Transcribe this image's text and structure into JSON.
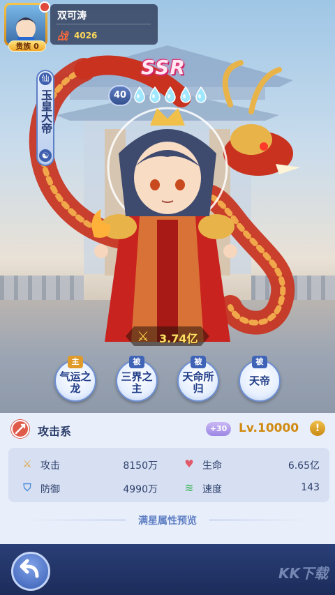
{
  "player": {
    "name": "双可涛",
    "vip_label": "贵族 0",
    "power_glyph": "战",
    "power": "4026"
  },
  "hero": {
    "title": "玉皇大帝",
    "faction_glyph": "仙",
    "camp_glyph": "☯",
    "rarity": "SSR",
    "level": "40",
    "star_count": 5,
    "battle_power": "3.74亿"
  },
  "skills": [
    {
      "type": "主",
      "name": "气运之龙",
      "kind": "main"
    },
    {
      "type": "被",
      "name": "三界之主",
      "kind": "passive"
    },
    {
      "type": "被",
      "name": "天命所归",
      "kind": "passive"
    },
    {
      "type": "被",
      "name": "天帝",
      "kind": "passive"
    }
  ],
  "attr": {
    "class_label": "攻击系",
    "bonus": "+30",
    "level_cap": "Lv.10000",
    "info_glyph": "!"
  },
  "stats": [
    {
      "label": "攻击",
      "value": "8150万",
      "icon": "sword-icon",
      "glyph": "⚔",
      "color": "#e0a23a"
    },
    {
      "label": "生命",
      "value": "6.65亿",
      "icon": "heart-icon",
      "glyph": "♥",
      "color": "#e05a6a"
    },
    {
      "label": "防御",
      "value": "4990万",
      "icon": "shield-icon",
      "glyph": "⛉",
      "color": "#4a8ad8"
    },
    {
      "label": "速度",
      "value": "143",
      "icon": "wind-icon",
      "glyph": "≋",
      "color": "#4cb86a"
    }
  ],
  "preview_label": "满星属性预览",
  "footer": {
    "back_glyph": "↩",
    "watermark": "KK下载"
  },
  "colors": {
    "accent": "#3f63b6",
    "gold": "#ffd95a",
    "level": "#d08a10"
  }
}
